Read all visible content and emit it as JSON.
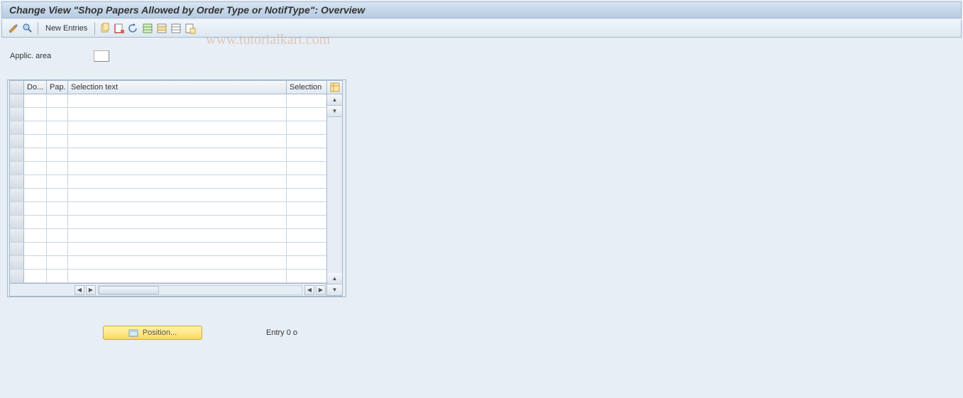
{
  "title": "Change View \"Shop Papers Allowed by Order Type or NotifType\": Overview",
  "toolbar": {
    "new_entries_label": "New Entries"
  },
  "watermark": "www.tutorialkart.com",
  "fields": {
    "applic_area_label": "Applic. area",
    "applic_area_value": ""
  },
  "grid": {
    "cols": {
      "do": "Do...",
      "pap": "Pap.",
      "seltext": "Selection text",
      "selection": "Selection"
    },
    "row_count": 14
  },
  "footer": {
    "position_label": "Position...",
    "entry_text": "Entry 0 o"
  }
}
